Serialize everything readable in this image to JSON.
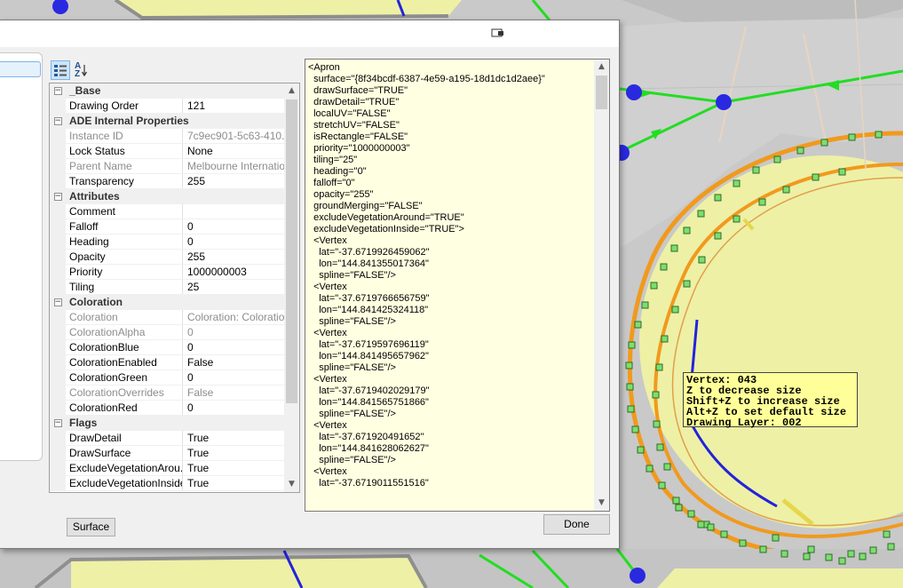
{
  "map": {
    "tooltip_lines": [
      "Vertex: 043",
      "Z to decrease size",
      "Shift+Z to increase size",
      "Alt+Z to set default size",
      "Drawing Layer: 002"
    ]
  },
  "dialog": {
    "toolbar": {
      "categorized_icon": "categorized-icon",
      "alpha_icon": "alphabetical-sort-icon",
      "alpha_label": "AZ"
    },
    "property_grid": {
      "rows": [
        {
          "kind": "category",
          "name": "_Base"
        },
        {
          "kind": "prop",
          "name": "Drawing Order",
          "value": "121",
          "readonly": false
        },
        {
          "kind": "category",
          "name": "ADE Internal Properties"
        },
        {
          "kind": "prop",
          "name": "Instance ID",
          "value": "7c9ec901-5c63-410...",
          "readonly": true
        },
        {
          "kind": "prop",
          "name": "Lock Status",
          "value": "None",
          "readonly": false
        },
        {
          "kind": "prop",
          "name": "Parent Name",
          "value": "Melbourne Internatio...",
          "readonly": true
        },
        {
          "kind": "prop",
          "name": "Transparency",
          "value": "255",
          "readonly": false
        },
        {
          "kind": "category",
          "name": "Attributes"
        },
        {
          "kind": "prop",
          "name": "Comment",
          "value": "",
          "readonly": false
        },
        {
          "kind": "prop",
          "name": "Falloff",
          "value": "0",
          "readonly": false
        },
        {
          "kind": "prop",
          "name": "Heading",
          "value": "0",
          "readonly": false
        },
        {
          "kind": "prop",
          "name": "Opacity",
          "value": "255",
          "readonly": false
        },
        {
          "kind": "prop",
          "name": "Priority",
          "value": "1000000003",
          "readonly": false
        },
        {
          "kind": "prop",
          "name": "Tiling",
          "value": "25",
          "readonly": false
        },
        {
          "kind": "category",
          "name": "Coloration"
        },
        {
          "kind": "prop",
          "name": "Coloration",
          "value": "Coloration: Coloration",
          "readonly": true
        },
        {
          "kind": "prop",
          "name": "ColorationAlpha",
          "value": "0",
          "readonly": true
        },
        {
          "kind": "prop",
          "name": "ColorationBlue",
          "value": "0",
          "readonly": false
        },
        {
          "kind": "prop",
          "name": "ColorationEnabled",
          "value": "False",
          "readonly": false
        },
        {
          "kind": "prop",
          "name": "ColorationGreen",
          "value": "0",
          "readonly": false
        },
        {
          "kind": "prop",
          "name": "ColorationOverrides",
          "value": "False",
          "readonly": true
        },
        {
          "kind": "prop",
          "name": "ColorationRed",
          "value": "0",
          "readonly": false
        },
        {
          "kind": "category",
          "name": "Flags"
        },
        {
          "kind": "prop",
          "name": "DrawDetail",
          "value": "True",
          "readonly": false
        },
        {
          "kind": "prop",
          "name": "DrawSurface",
          "value": "True",
          "readonly": false
        },
        {
          "kind": "prop",
          "name": "ExcludeVegetationArou...",
          "value": "True",
          "readonly": false
        },
        {
          "kind": "prop",
          "name": "ExcludeVegetationInside",
          "value": "True",
          "readonly": false
        }
      ]
    },
    "xml_text": "<Apron\n  surface=\"{8f34bcdf-6387-4e59-a195-18d1dc1d2aee}\"\n  drawSurface=\"TRUE\"\n  drawDetail=\"TRUE\"\n  localUV=\"FALSE\"\n  stretchUV=\"FALSE\"\n  isRectangle=\"FALSE\"\n  priority=\"1000000003\"\n  tiling=\"25\"\n  heading=\"0\"\n  falloff=\"0\"\n  opacity=\"255\"\n  groundMerging=\"FALSE\"\n  excludeVegetationAround=\"TRUE\"\n  excludeVegetationInside=\"TRUE\">\n  <Vertex\n    lat=\"-37.6719926459062\"\n    lon=\"144.841355017364\"\n    spline=\"FALSE\"/>\n  <Vertex\n    lat=\"-37.6719766656759\"\n    lon=\"144.841425324118\"\n    spline=\"FALSE\"/>\n  <Vertex\n    lat=\"-37.6719597696119\"\n    lon=\"144.841495657962\"\n    spline=\"FALSE\"/>\n  <Vertex\n    lat=\"-37.6719402029179\"\n    lon=\"144.841565751866\"\n    spline=\"FALSE\"/>\n  <Vertex\n    lat=\"-37.671920491652\"\n    lon=\"144.841628062627\"\n    spline=\"FALSE\"/>\n  <Vertex\n    lat=\"-37.6719011551516\"",
    "surface_button": "Surface",
    "done_button": "Done"
  },
  "colors": {
    "grass": "#eef0a6",
    "apron_outline": "#f09a1e",
    "vertex_green": "#22dd22",
    "node_blue": "#2929e0",
    "vertex_box": "#7dde6d"
  }
}
